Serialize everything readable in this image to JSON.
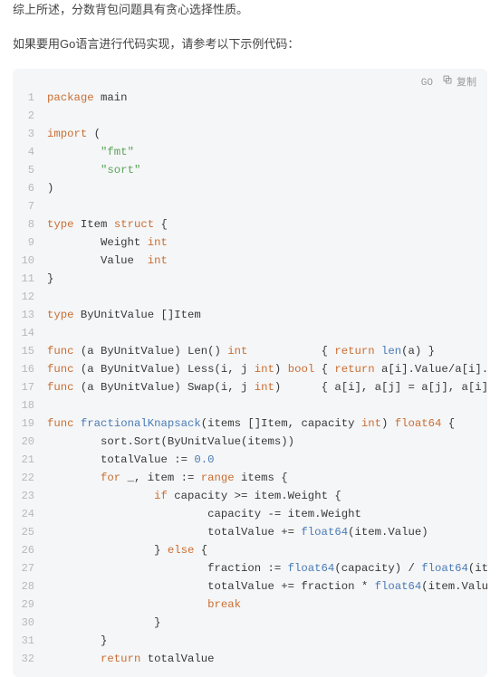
{
  "paragraphs": {
    "p1": "综上所述，分数背包问题具有贪心选择性质。",
    "p2": "如果要用Go语言进行代码实现，请参考以下示例代码："
  },
  "code_block": {
    "language_label": "GO",
    "copy_label": "复制",
    "lines": [
      {
        "n": "1",
        "segments": [
          {
            "c": "kw",
            "t": "package"
          },
          {
            "c": "plain",
            "t": " main"
          }
        ]
      },
      {
        "n": "2",
        "segments": []
      },
      {
        "n": "3",
        "segments": [
          {
            "c": "kw",
            "t": "import"
          },
          {
            "c": "plain",
            "t": " ("
          }
        ]
      },
      {
        "n": "4",
        "segments": [
          {
            "c": "plain",
            "t": "        "
          },
          {
            "c": "str",
            "t": "\"fmt\""
          }
        ]
      },
      {
        "n": "5",
        "segments": [
          {
            "c": "plain",
            "t": "        "
          },
          {
            "c": "str",
            "t": "\"sort\""
          }
        ]
      },
      {
        "n": "6",
        "segments": [
          {
            "c": "plain",
            "t": ")"
          }
        ]
      },
      {
        "n": "7",
        "segments": []
      },
      {
        "n": "8",
        "segments": [
          {
            "c": "kw",
            "t": "type"
          },
          {
            "c": "plain",
            "t": " Item "
          },
          {
            "c": "kw",
            "t": "struct"
          },
          {
            "c": "plain",
            "t": " {"
          }
        ]
      },
      {
        "n": "9",
        "segments": [
          {
            "c": "plain",
            "t": "        Weight "
          },
          {
            "c": "ty",
            "t": "int"
          }
        ]
      },
      {
        "n": "10",
        "segments": [
          {
            "c": "plain",
            "t": "        Value  "
          },
          {
            "c": "ty",
            "t": "int"
          }
        ]
      },
      {
        "n": "11",
        "segments": [
          {
            "c": "plain",
            "t": "}"
          }
        ]
      },
      {
        "n": "12",
        "segments": []
      },
      {
        "n": "13",
        "segments": [
          {
            "c": "kw",
            "t": "type"
          },
          {
            "c": "plain",
            "t": " ByUnitValue []Item"
          }
        ]
      },
      {
        "n": "14",
        "segments": []
      },
      {
        "n": "15",
        "segments": [
          {
            "c": "kw",
            "t": "func"
          },
          {
            "c": "plain",
            "t": " (a ByUnitValue) Len() "
          },
          {
            "c": "ty",
            "t": "int"
          },
          {
            "c": "plain",
            "t": "           { "
          },
          {
            "c": "kw",
            "t": "return"
          },
          {
            "c": "plain",
            "t": " "
          },
          {
            "c": "builtin",
            "t": "len"
          },
          {
            "c": "plain",
            "t": "(a) }"
          }
        ]
      },
      {
        "n": "16",
        "segments": [
          {
            "c": "kw",
            "t": "func"
          },
          {
            "c": "plain",
            "t": " (a ByUnitValue) Less(i, j "
          },
          {
            "c": "ty",
            "t": "int"
          },
          {
            "c": "plain",
            "t": ") "
          },
          {
            "c": "ty",
            "t": "bool"
          },
          {
            "c": "plain",
            "t": " { "
          },
          {
            "c": "kw",
            "t": "return"
          },
          {
            "c": "plain",
            "t": " a[i].Value/a[i].Wei"
          }
        ]
      },
      {
        "n": "17",
        "segments": [
          {
            "c": "kw",
            "t": "func"
          },
          {
            "c": "plain",
            "t": " (a ByUnitValue) Swap(i, j "
          },
          {
            "c": "ty",
            "t": "int"
          },
          {
            "c": "plain",
            "t": ")      { a[i], a[j] = a[j], a[i] }"
          }
        ]
      },
      {
        "n": "18",
        "segments": []
      },
      {
        "n": "19",
        "segments": [
          {
            "c": "kw",
            "t": "func"
          },
          {
            "c": "plain",
            "t": " "
          },
          {
            "c": "fn",
            "t": "fractionalKnapsack"
          },
          {
            "c": "plain",
            "t": "(items []Item, capacity "
          },
          {
            "c": "ty",
            "t": "int"
          },
          {
            "c": "plain",
            "t": ") "
          },
          {
            "c": "ty",
            "t": "float64"
          },
          {
            "c": "plain",
            "t": " {"
          }
        ]
      },
      {
        "n": "20",
        "segments": [
          {
            "c": "plain",
            "t": "        sort.Sort(ByUnitValue(items))"
          }
        ]
      },
      {
        "n": "21",
        "segments": [
          {
            "c": "plain",
            "t": "        totalValue := "
          },
          {
            "c": "num",
            "t": "0.0"
          }
        ]
      },
      {
        "n": "22",
        "segments": [
          {
            "c": "plain",
            "t": "        "
          },
          {
            "c": "kw",
            "t": "for"
          },
          {
            "c": "plain",
            "t": " _, item := "
          },
          {
            "c": "kw",
            "t": "range"
          },
          {
            "c": "plain",
            "t": " items {"
          }
        ]
      },
      {
        "n": "23",
        "segments": [
          {
            "c": "plain",
            "t": "                "
          },
          {
            "c": "kw",
            "t": "if"
          },
          {
            "c": "plain",
            "t": " capacity >= item.Weight {"
          }
        ]
      },
      {
        "n": "24",
        "segments": [
          {
            "c": "plain",
            "t": "                        capacity -= item.Weight"
          }
        ]
      },
      {
        "n": "25",
        "segments": [
          {
            "c": "plain",
            "t": "                        totalValue += "
          },
          {
            "c": "builtin",
            "t": "float64"
          },
          {
            "c": "plain",
            "t": "(item.Value)"
          }
        ]
      },
      {
        "n": "26",
        "segments": [
          {
            "c": "plain",
            "t": "                } "
          },
          {
            "c": "kw",
            "t": "else"
          },
          {
            "c": "plain",
            "t": " {"
          }
        ]
      },
      {
        "n": "27",
        "segments": [
          {
            "c": "plain",
            "t": "                        fraction := "
          },
          {
            "c": "builtin",
            "t": "float64"
          },
          {
            "c": "plain",
            "t": "(capacity) / "
          },
          {
            "c": "builtin",
            "t": "float64"
          },
          {
            "c": "plain",
            "t": "(item."
          }
        ]
      },
      {
        "n": "28",
        "segments": [
          {
            "c": "plain",
            "t": "                        totalValue += fraction * "
          },
          {
            "c": "builtin",
            "t": "float64"
          },
          {
            "c": "plain",
            "t": "(item.Value)"
          }
        ]
      },
      {
        "n": "29",
        "segments": [
          {
            "c": "plain",
            "t": "                        "
          },
          {
            "c": "kw",
            "t": "break"
          }
        ]
      },
      {
        "n": "30",
        "segments": [
          {
            "c": "plain",
            "t": "                }"
          }
        ]
      },
      {
        "n": "31",
        "segments": [
          {
            "c": "plain",
            "t": "        }"
          }
        ]
      },
      {
        "n": "32",
        "segments": [
          {
            "c": "plain",
            "t": "        "
          },
          {
            "c": "kw",
            "t": "return"
          },
          {
            "c": "plain",
            "t": " totalValue"
          }
        ]
      }
    ]
  }
}
